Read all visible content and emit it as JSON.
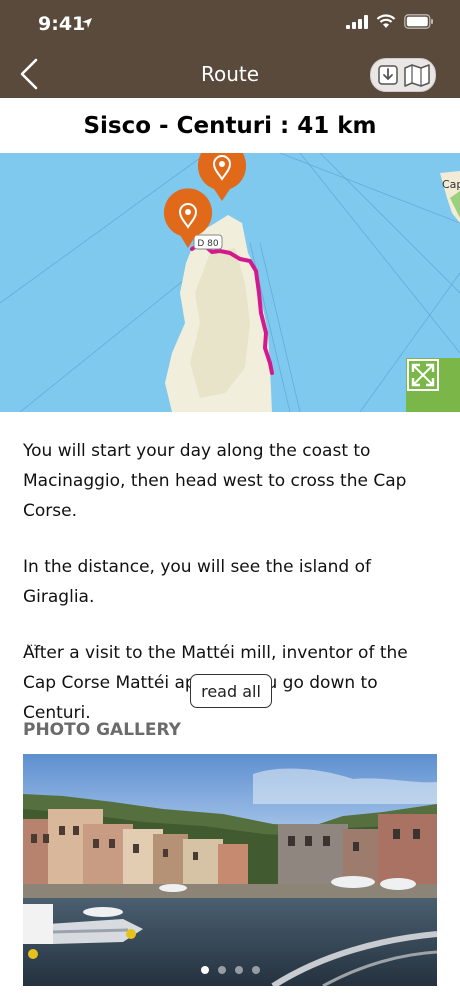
{
  "status": {
    "time": "9:41"
  },
  "nav": {
    "title": "Route"
  },
  "route": {
    "title": "Sisco - Centuri : 41 km"
  },
  "map": {
    "road_label": "D 80",
    "place_label": "Cap"
  },
  "description": {
    "paragraphs": [
      "You will start your day along the coast to Macinaggio, then head west to cross the Cap Corse.",
      "In the distance, you will see the island of Giraglia.",
      "After a visit to the Mattéi mill, inventor of the Cap Corse Mattéi aperitif, you go down to Centuri."
    ],
    "ellipsis": "...",
    "read_all_label": "read all"
  },
  "gallery": {
    "heading": "PHOTO GALLERY",
    "photo_count": 4,
    "active_index": 0
  },
  "colors": {
    "header_bg": "#5a4a3c",
    "sea": "#7fc9ee",
    "route_line": "#d4198c",
    "pin": "#e06a1a",
    "expand_button": "#7ab648"
  }
}
